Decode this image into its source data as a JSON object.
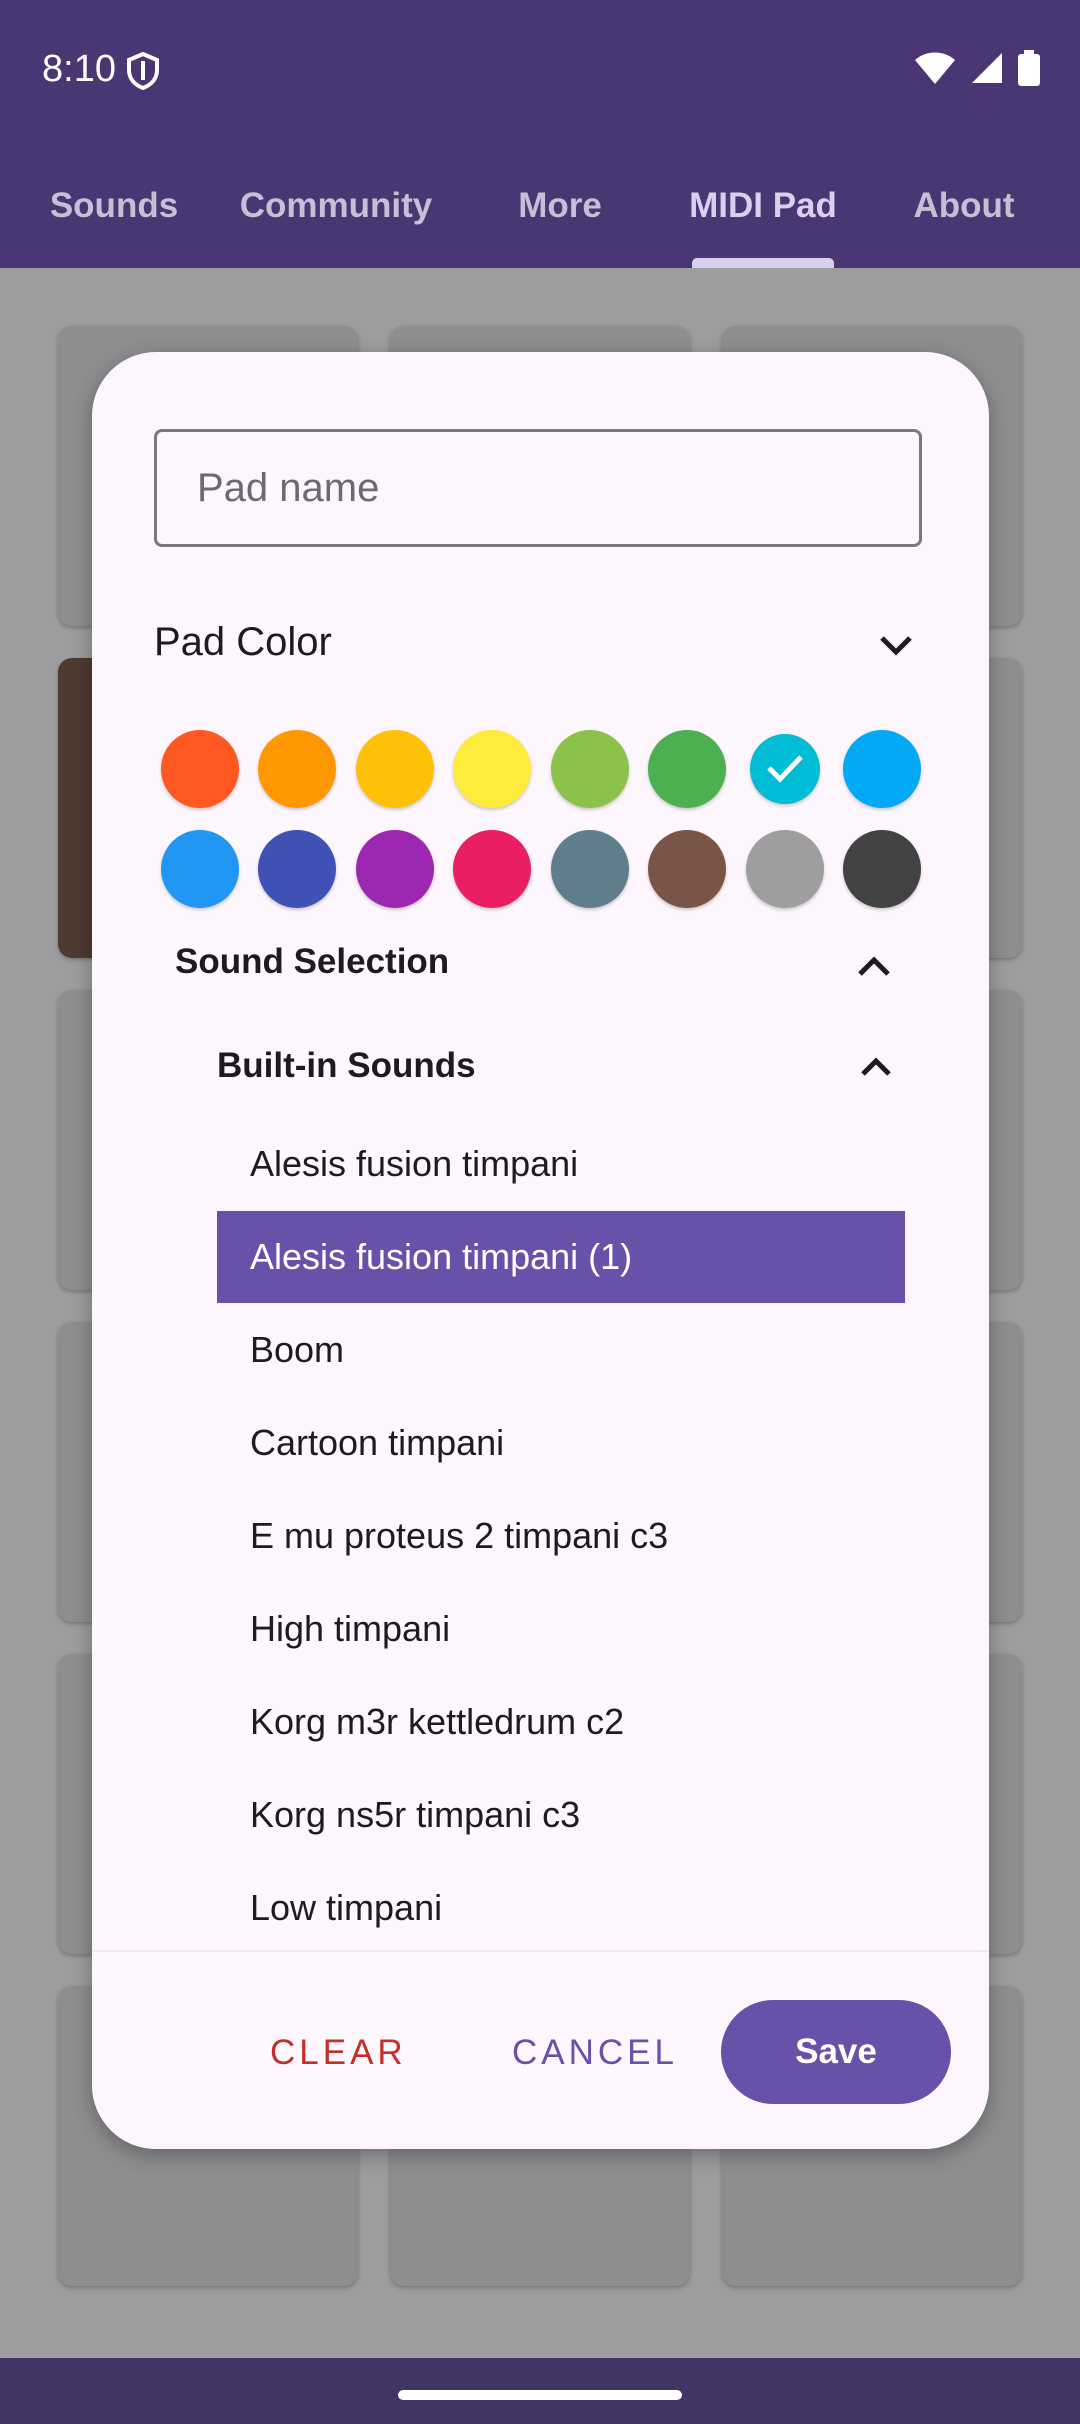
{
  "status_bar": {
    "time": "8:10"
  },
  "tabs": [
    {
      "label": "Sounds"
    },
    {
      "label": "Community"
    },
    {
      "label": "More"
    },
    {
      "label": "MIDI Pad"
    },
    {
      "label": "About"
    }
  ],
  "active_tab": "MIDI Pad",
  "dialog": {
    "name_placeholder": "Pad name",
    "name_value": "",
    "color_section_label": "Pad Color",
    "colors": [
      {
        "hex": "#ff5722"
      },
      {
        "hex": "#ff9800"
      },
      {
        "hex": "#ffc107"
      },
      {
        "hex": "#ffeb3b"
      },
      {
        "hex": "#8bc34a"
      },
      {
        "hex": "#4caf50"
      },
      {
        "hex": "#00bcd4",
        "selected": true
      },
      {
        "hex": "#03a9f4"
      },
      {
        "hex": "#2196f3"
      },
      {
        "hex": "#3f51b5"
      },
      {
        "hex": "#9c27b0"
      },
      {
        "hex": "#e91e63"
      },
      {
        "hex": "#607d8b"
      },
      {
        "hex": "#795548"
      },
      {
        "hex": "#9e9e9e"
      },
      {
        "hex": "#424242"
      }
    ],
    "sound_section_label": "Sound Selection",
    "builtin_label": "Built-in Sounds",
    "sounds": [
      {
        "label": "Alesis fusion timpani"
      },
      {
        "label": "Alesis fusion timpani (1)",
        "selected": true
      },
      {
        "label": "Boom"
      },
      {
        "label": "Cartoon timpani"
      },
      {
        "label": "E mu proteus 2 timpani c3"
      },
      {
        "label": "High timpani"
      },
      {
        "label": "Korg m3r kettledrum c2"
      },
      {
        "label": "Korg ns5r timpani c3"
      },
      {
        "label": "Low timpani"
      }
    ],
    "buttons": {
      "clear": "CLEAR",
      "cancel": "CANCEL",
      "save": "Save"
    }
  },
  "colors": {
    "app_bar": "#4a3672",
    "accent": "#6950a8",
    "danger": "#c3302c",
    "dialog_bg": "#fdf6fc"
  }
}
